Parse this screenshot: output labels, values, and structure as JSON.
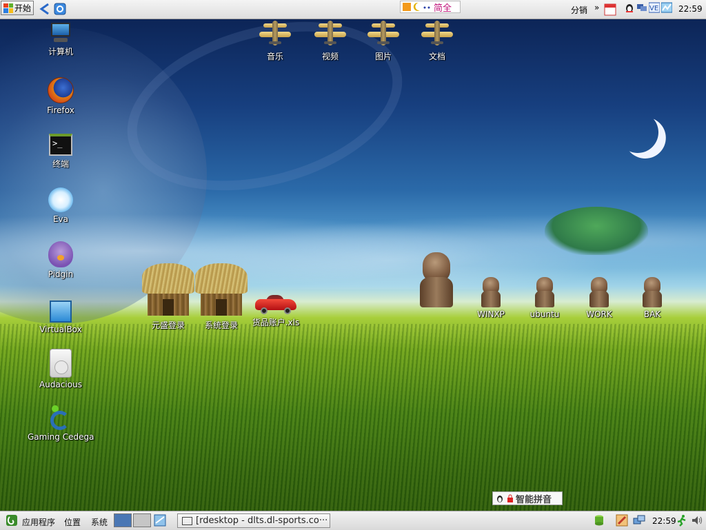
{
  "top_panel": {
    "start_label": "开始",
    "ime_label": "简全",
    "tray_label": "分销",
    "clock": "22:59"
  },
  "desktop": {
    "left_icons": [
      {
        "label": "计算机"
      },
      {
        "label": "Firefox"
      },
      {
        "label": "终端"
      },
      {
        "label": "Eva"
      },
      {
        "label": "Pidgin"
      },
      {
        "label": "VirtualBox"
      },
      {
        "label": "Audacious"
      },
      {
        "label": "Gaming Cedega"
      }
    ],
    "top_icons": [
      {
        "label": "音乐"
      },
      {
        "label": "视频"
      },
      {
        "label": "图片"
      },
      {
        "label": "文档"
      }
    ],
    "mid_icons": [
      {
        "label": "元盛登录"
      },
      {
        "label": "系统登录"
      },
      {
        "label": "货品账户.xls"
      }
    ],
    "statue_icons": [
      {
        "label": "WINXP"
      },
      {
        "label": "ubuntu"
      },
      {
        "label": "WORK"
      },
      {
        "label": "BAK"
      }
    ]
  },
  "ime_bar": {
    "label": "智能拼音"
  },
  "bottom_panel": {
    "menu_apps": "应用程序",
    "menu_places": "位置",
    "menu_system": "系统",
    "task_title": "[rdesktop - dlts.dl-sports.co···",
    "clock": "22:59"
  },
  "colors": {
    "panel_bg": "#e6e6e6",
    "ime_accent": "#c0137a",
    "workspace_active": "#4a77b4"
  }
}
